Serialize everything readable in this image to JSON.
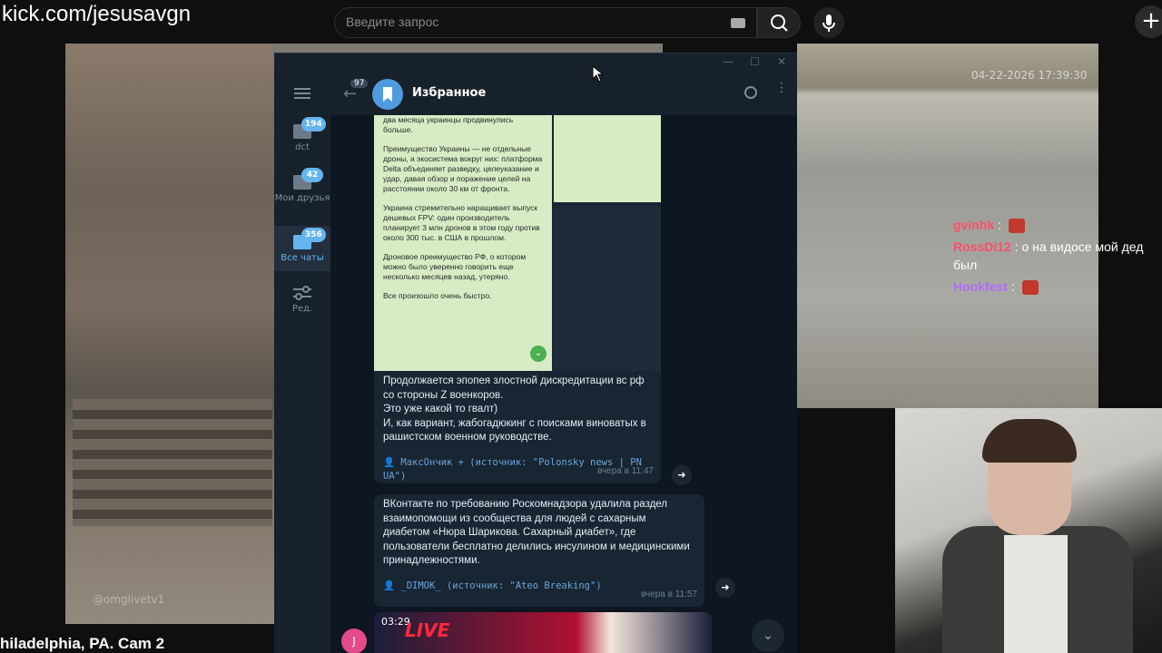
{
  "browser": {
    "url": "kick.com/jesusavgn",
    "search_placeholder": "Введите запрос",
    "plus_label": "+"
  },
  "stream": {
    "caption": "hiladelphia, PA. Cam 2",
    "watermark": "@omglivetv1",
    "timestamp": "04-22-2026 17:39:30",
    "chat": [
      {
        "user": "gvinhk",
        "text": ""
      },
      {
        "user": "RossDi12",
        "text": ": о на видосе мой дед был"
      },
      {
        "user": "Hookfest",
        "text": ""
      }
    ]
  },
  "telegram": {
    "window_buttons": [
      "—",
      "☐",
      "✕"
    ],
    "folders": [
      {
        "label": "dct",
        "badge": "194"
      },
      {
        "label": "Мои друзья",
        "badge": "42"
      },
      {
        "label": "Все чаты",
        "badge": "356"
      },
      {
        "label": "Ред.",
        "badge": ""
      }
    ],
    "back_badge": "97",
    "chat_title": "Избранное",
    "image_text": [
      "два месяца украинцы продвинулись больше.",
      "Преимущество Украины — не отдельные дроны, а экосистема вокруг них: платформа Delta объединяет разведку, целеуказание и удар, давая обзор и поражение целей на расстоянии около 30 км от фронта.",
      "Украина стремительно наращивает выпуск дешевых FPV: один производитель планирует 3 млн дронов в этом году против около 300 тыс. в США в прошлом.",
      "Дроновое преимущество РФ, о котором можно было уверенно говорить еще несколько месяцев назад, утеряно.",
      "Все произошло очень быстро."
    ],
    "messages": [
      {
        "text": "Продолжается эпопея злостной дискредитации вс рф со стороны Z военкоров.\nЭто уже какой то гвалт)\nИ, как вариант, жабогадюкинг с поисками виноватых в рашистском военном руководстве.",
        "source": "👤 МаксОнчик + (источник: \"Polonsky news | PN UA\")",
        "time": "вчера в 11:47"
      },
      {
        "text": "ВКонтакте по требованию Роскомнадзора удалила раздел взаимопомощи из сообщества для людей с сахарным диабетом «Нюра Шарикова. Сахарный диабет», где пользователи бесплатно делились инсулином и медицинскими принадлежностями.",
        "source": "👤 _DIMOK_ (источник: \"Ateo Breaking\")",
        "time": "вчера в 11:57"
      }
    ],
    "video": {
      "duration": "03:29",
      "logo": "LIVE"
    },
    "user_avatar_letter": "J"
  },
  "colors": {
    "tg_bg": "#0e1621",
    "tg_panel": "#17212b",
    "accent": "#64b5ef",
    "bubble": "#182533"
  }
}
